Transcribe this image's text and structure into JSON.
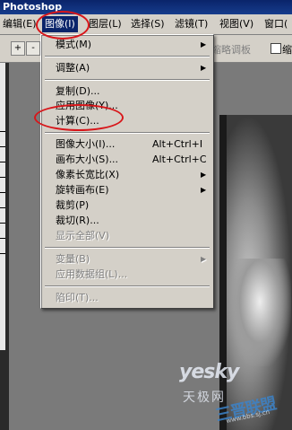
{
  "app": {
    "title": "Photoshop"
  },
  "menubar": {
    "items": [
      {
        "label": "编辑(E)"
      },
      {
        "label": "图像(I)"
      },
      {
        "label": "图层(L)"
      },
      {
        "label": "选择(S)"
      },
      {
        "label": "滤镜(T)"
      },
      {
        "label": "视图(V)"
      },
      {
        "label": "窗口("
      }
    ]
  },
  "options": {
    "zoom_in": "+",
    "zoom_out": "-",
    "hidden_label": "缩略调板",
    "checkbox_label": "缩"
  },
  "menu": {
    "items": [
      {
        "label": "模式(M)",
        "submenu": true
      },
      {
        "label": "调整(A)",
        "submenu": true
      },
      {
        "label": "复制(D)..."
      },
      {
        "label": "应用图像(Y)..."
      },
      {
        "label": "计算(C)..."
      },
      {
        "label": "图像大小(I)...",
        "shortcut": "Alt+Ctrl+I"
      },
      {
        "label": "画布大小(S)...",
        "shortcut": "Alt+Ctrl+C"
      },
      {
        "label": "像素长宽比(X)",
        "submenu": true
      },
      {
        "label": "旋转画布(E)",
        "submenu": true
      },
      {
        "label": "裁剪(P)"
      },
      {
        "label": "裁切(R)..."
      },
      {
        "label": "显示全部(V)",
        "disabled": true
      },
      {
        "label": "变量(B)",
        "submenu": true,
        "disabled": true
      },
      {
        "label": "应用数据组(L)...",
        "disabled": true
      },
      {
        "label": "陷印(T)...",
        "disabled": true
      }
    ],
    "arrow_glyph": "▶"
  },
  "watermark": {
    "brand": "yesky",
    "sub": "天极网",
    "logo": "三晋联盟",
    "url": "www.bbs.sj.cn"
  },
  "colors": {
    "highlight": "#0a246a",
    "menu_bg": "#d4d0c8",
    "annotation": "#d8161a"
  }
}
